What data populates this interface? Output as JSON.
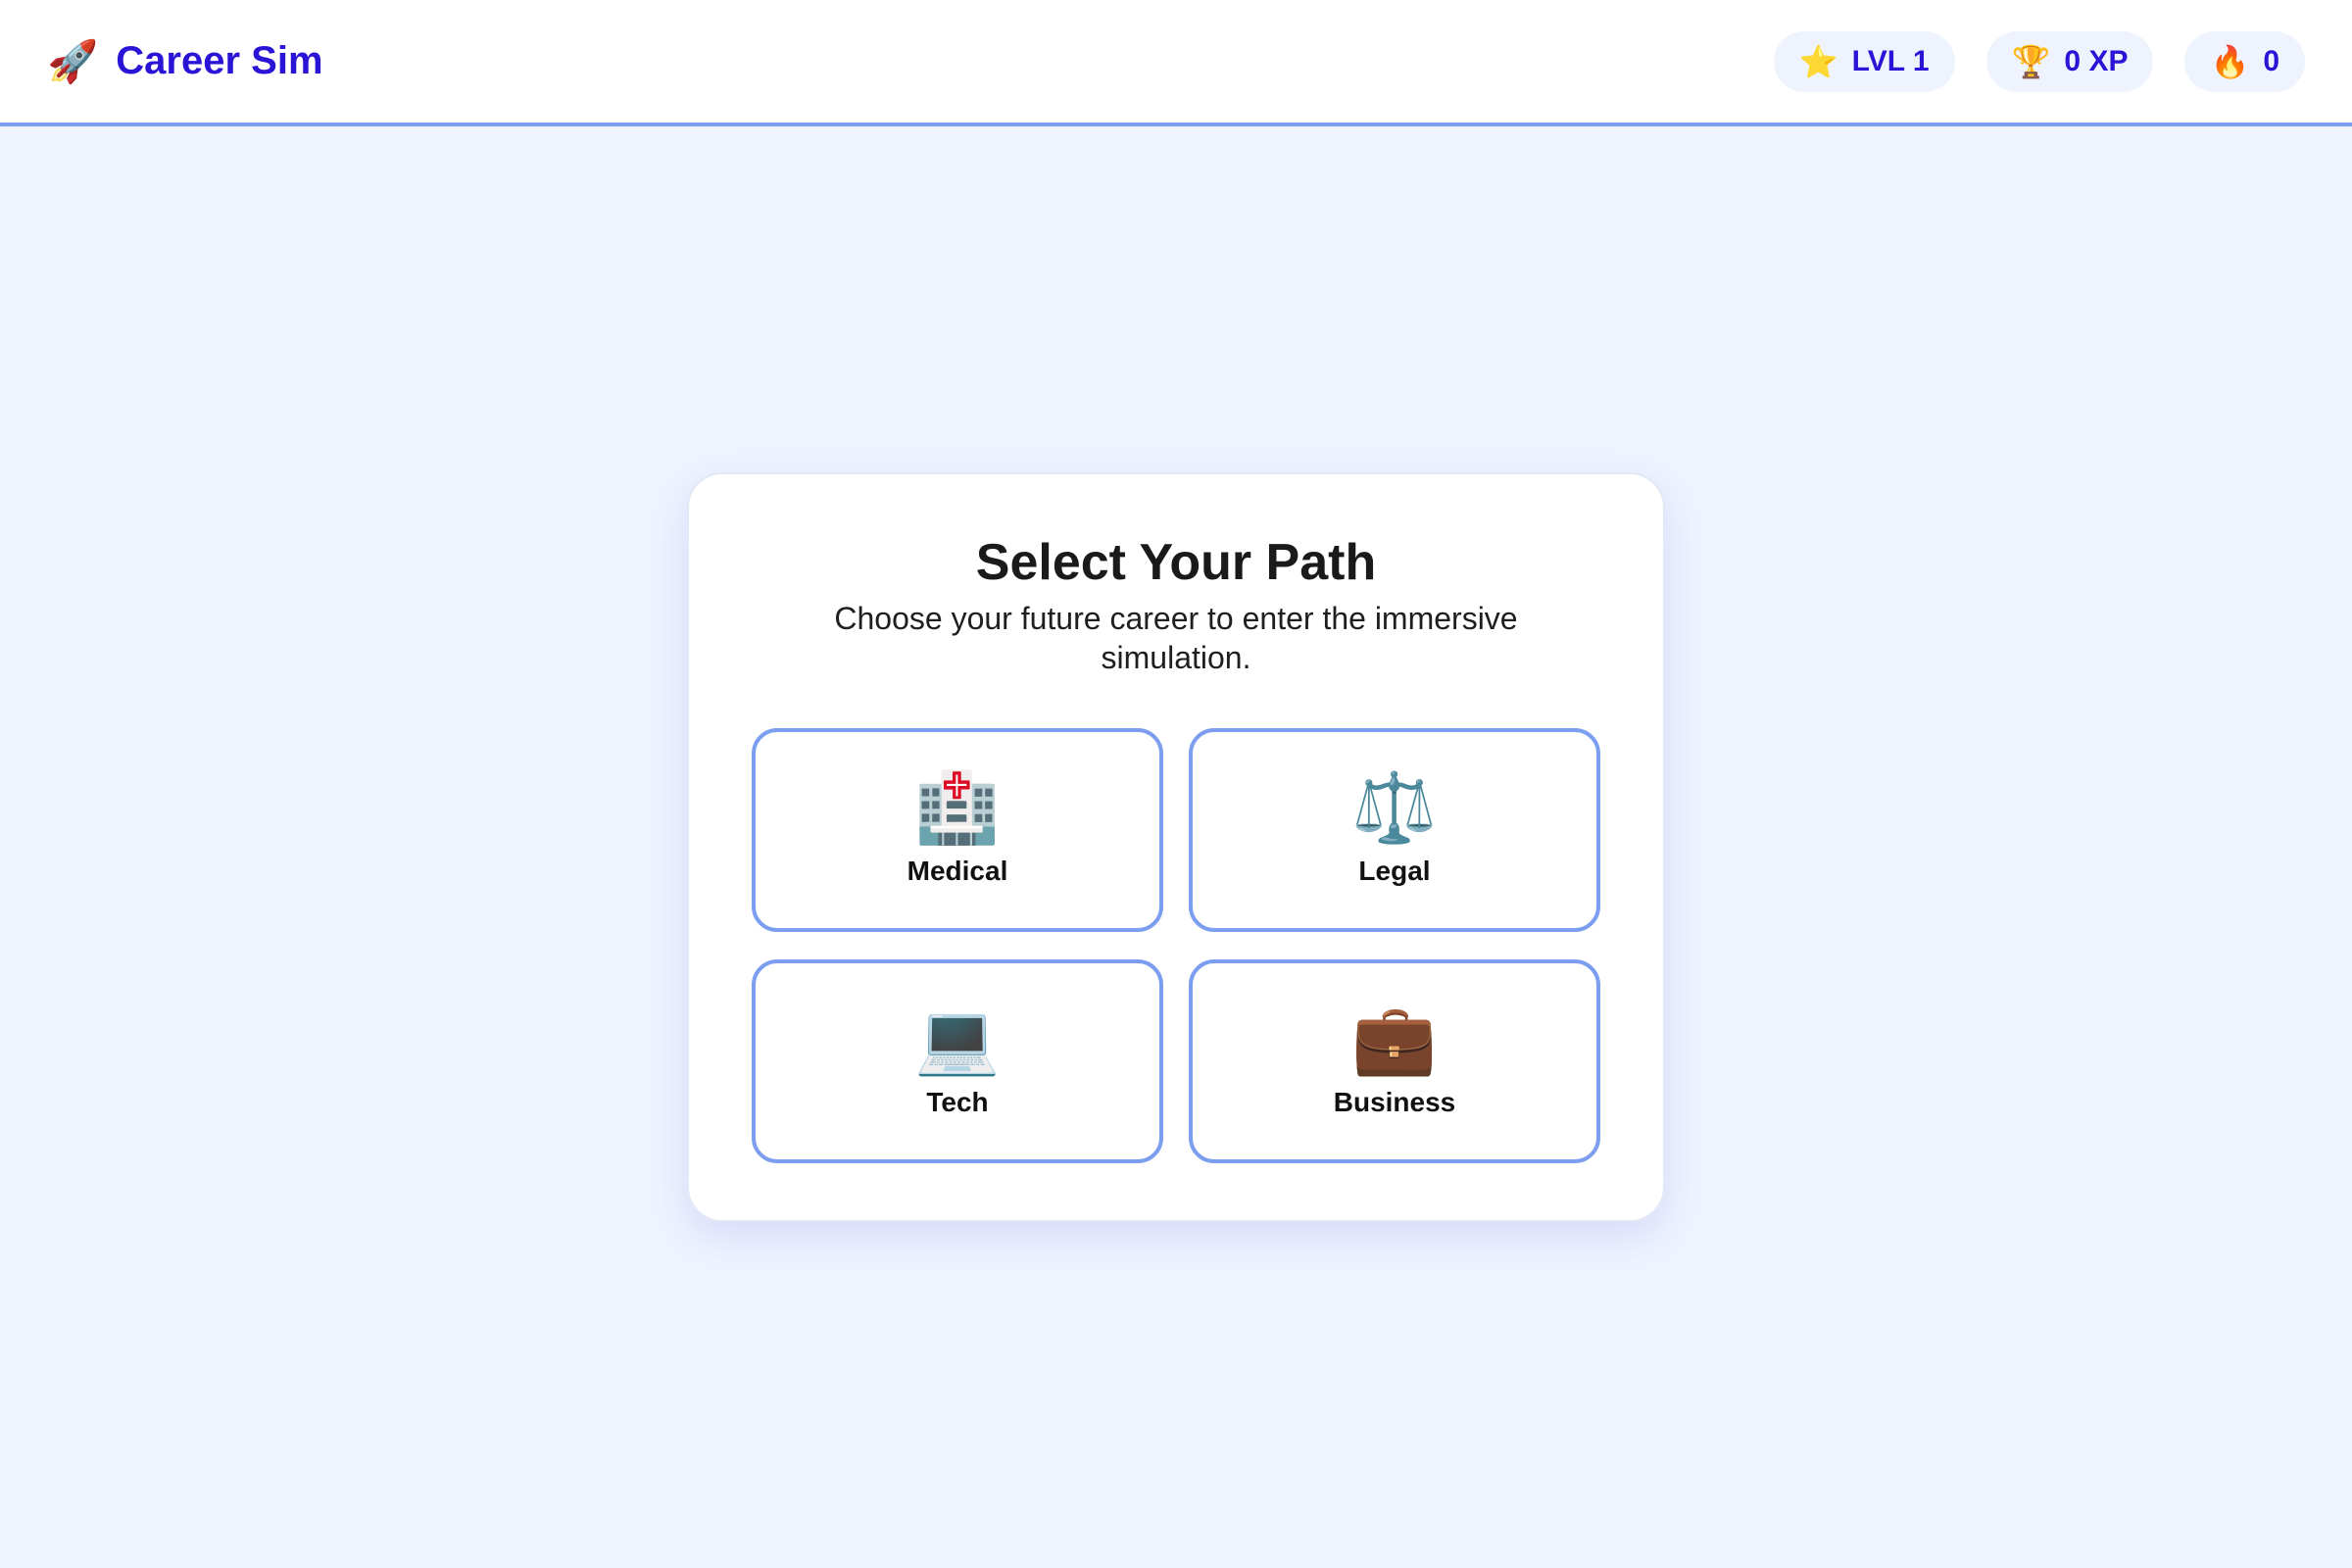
{
  "header": {
    "brand_icon": "🚀",
    "brand_icon_name": "rocket-icon",
    "brand_name": "Career Sim",
    "stats": [
      {
        "icon": "⭐",
        "icon_name": "star-icon",
        "label": "LVL 1"
      },
      {
        "icon": "🏆",
        "icon_name": "trophy-icon",
        "label": "0 XP"
      },
      {
        "icon": "🔥",
        "icon_name": "fire-icon",
        "label": "0"
      }
    ]
  },
  "main": {
    "title": "Select Your Path",
    "subtitle": "Choose your future career to enter the immersive simulation.",
    "paths": [
      {
        "icon": "🏥",
        "icon_name": "hospital-icon",
        "label": "Medical"
      },
      {
        "icon": "⚖️",
        "icon_name": "scales-icon",
        "label": "Legal"
      },
      {
        "icon": "💻",
        "icon_name": "laptop-icon",
        "label": "Tech"
      },
      {
        "icon": "💼",
        "icon_name": "briefcase-icon",
        "label": "Business"
      }
    ]
  },
  "colors": {
    "accent": "#2a14d6",
    "border": "#7b9ef0",
    "background": "#eef3fe"
  }
}
